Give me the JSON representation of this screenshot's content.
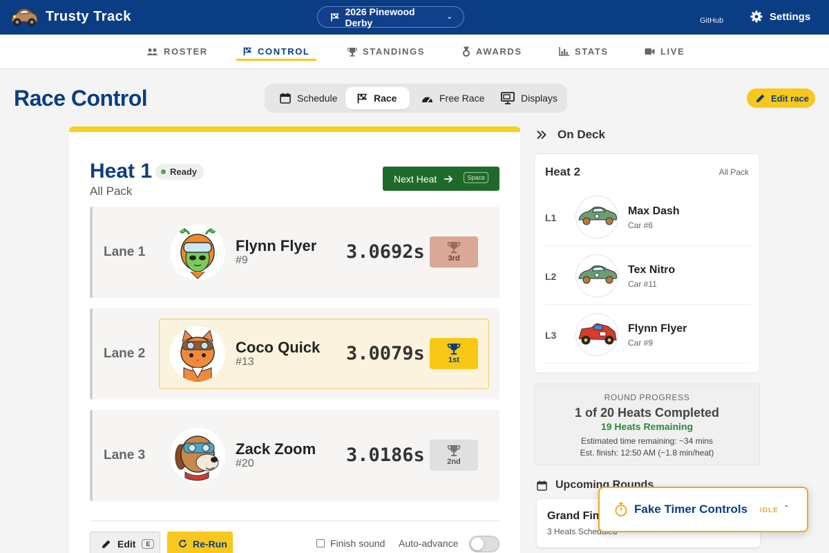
{
  "app": {
    "title": "Trusty Track",
    "event": "2026 Pinewood Derby",
    "github": "GitHub",
    "settings": "Settings"
  },
  "nav": {
    "tabs": [
      {
        "label": "ROSTER",
        "icon": "people-icon"
      },
      {
        "label": "CONTROL",
        "icon": "flag-icon",
        "active": true
      },
      {
        "label": "STANDINGS",
        "icon": "trophy-icon"
      },
      {
        "label": "AWARDS",
        "icon": "medal-icon"
      },
      {
        "label": "STATS",
        "icon": "bar-chart-icon"
      },
      {
        "label": "LIVE",
        "icon": "video-icon"
      }
    ]
  },
  "page": {
    "title": "Race Control",
    "modes": [
      "Schedule",
      "Race",
      "Free Race",
      "Displays"
    ],
    "active_mode": "Race",
    "edit_race": "Edit race"
  },
  "heat": {
    "title": "Heat 1",
    "status": "Ready",
    "group": "All Pack",
    "next_label": "Next Heat",
    "next_shortcut": "Space",
    "lanes": [
      {
        "lane": "Lane 1",
        "name": "Flynn Flyer",
        "number": "#9",
        "time": "3.0692s",
        "place": "3rd",
        "avatar": "alien-avatar"
      },
      {
        "lane": "Lane 2",
        "name": "Coco Quick",
        "number": "#13",
        "time": "3.0079s",
        "place": "1st",
        "avatar": "cat-avatar"
      },
      {
        "lane": "Lane 3",
        "name": "Zack Zoom",
        "number": "#20",
        "time": "3.0186s",
        "place": "2nd",
        "avatar": "dog-avatar"
      }
    ],
    "edit_label": "Edit",
    "edit_shortcut": "E",
    "rerun_label": "Re-Run",
    "finish_sound": "Finish sound",
    "auto_advance": "Auto-advance"
  },
  "ondeck": {
    "header": "On Deck",
    "title": "Heat 2",
    "group": "All Pack",
    "entries": [
      {
        "lane": "L1",
        "name": "Max Dash",
        "car": "Car #6"
      },
      {
        "lane": "L2",
        "name": "Tex Nitro",
        "car": "Car #11"
      },
      {
        "lane": "L3",
        "name": "Flynn Flyer",
        "car": "Car #9"
      }
    ]
  },
  "progress": {
    "label": "ROUND PROGRESS",
    "completed": "1 of 20 Heats Completed",
    "remaining": "19 Heats Remaining",
    "est_time": "Estimated time remaining: ~34 mins",
    "est_finish": "Est. finish: 12:50 AM (~1.8 min/heat)"
  },
  "upcoming": {
    "header": "Upcoming Rounds",
    "title": "Grand Final",
    "subtitle": "3 Heats Scheduled"
  },
  "fake_timer": {
    "title": "Fake Timer Controls",
    "state": "IDLE"
  },
  "colors": {
    "brand": "#0b3d84",
    "accent": "#f8c81d",
    "success": "#1f6a2a"
  }
}
